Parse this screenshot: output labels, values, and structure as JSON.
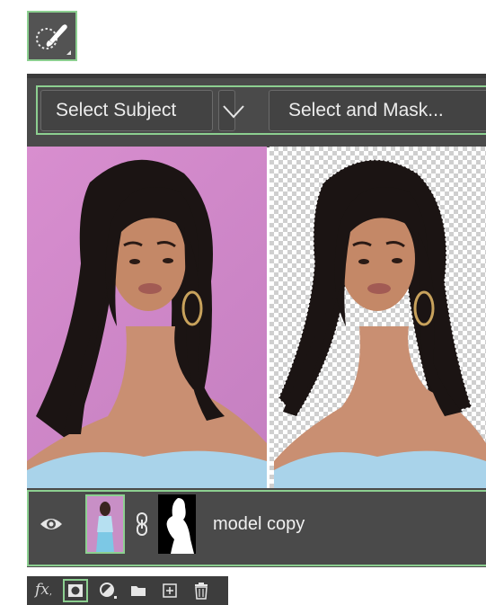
{
  "tool": {
    "icon": "quick-selection-brush-icon"
  },
  "options_bar": {
    "select_subject_label": "Select Subject",
    "dropdown_icon": "chevron-down-icon",
    "select_and_mask_label": "Select and Mask..."
  },
  "canvas": {
    "left_image": "original photo with pink background",
    "right_image": "subject cut out on transparent background"
  },
  "layer": {
    "visibility_icon": "eye-icon",
    "link_icon": "chain-link-icon",
    "name": "model copy"
  },
  "layer_toolbar": {
    "fx_label": "fx",
    "icons": [
      "fx-icon",
      "add-mask-icon",
      "adjustment-layer-icon",
      "folder-icon",
      "new-layer-icon",
      "trash-icon"
    ]
  },
  "colors": {
    "highlight": "#8ccf90",
    "panel": "#4a4a4a",
    "background_pink": "#d08ac8"
  }
}
